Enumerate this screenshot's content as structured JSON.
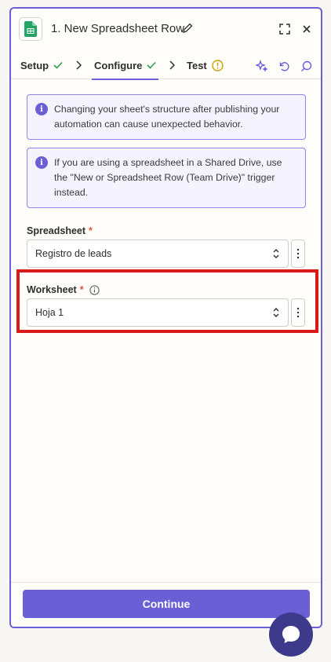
{
  "header": {
    "title": "1. New Spreadsheet Row",
    "icons": {
      "app": "google-sheets-icon",
      "edit": "pencil-icon",
      "expand": "expand-icon",
      "close": "close-icon"
    }
  },
  "tabs": [
    {
      "label": "Setup",
      "status": "check"
    },
    {
      "label": "Configure",
      "status": "check"
    },
    {
      "label": "Test",
      "status": "warning"
    }
  ],
  "toolbar_icons": [
    "sparkle-icon",
    "undo-icon",
    "search-icon"
  ],
  "alerts": [
    {
      "text": "Changing your sheet's structure after publishing your automation can cause unexpected behavior."
    },
    {
      "text": "If you are using a spreadsheet in a Shared Drive, use the \"New or Spreadsheet Row (Team Drive)\" trigger instead."
    }
  ],
  "fields": {
    "spreadsheet": {
      "label": "Spreadsheet",
      "required_mark": "*",
      "value": "Registro de leads"
    },
    "worksheet": {
      "label": "Worksheet",
      "required_mark": "*",
      "value": "Hoja 1"
    }
  },
  "footer": {
    "continue_label": "Continue"
  },
  "colors": {
    "accent": "#6b5fd6",
    "highlight": "#d91a1a",
    "required": "#e0553a",
    "check": "#2e9e4f",
    "warning": "#c9a200"
  }
}
